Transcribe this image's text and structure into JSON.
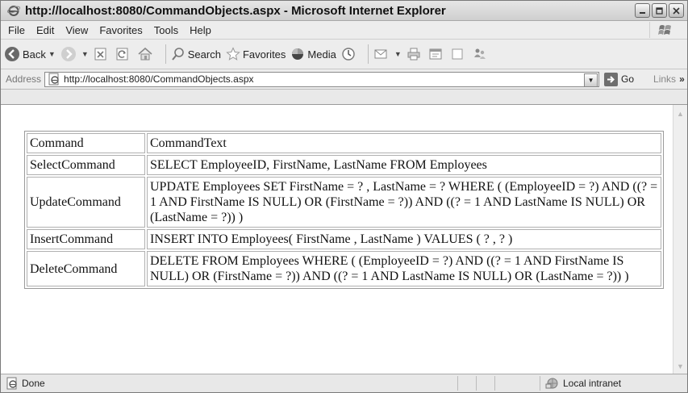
{
  "window": {
    "title": "http://localhost:8080/CommandObjects.aspx - Microsoft Internet Explorer",
    "controls": {
      "minimize": "minimize-icon",
      "maximize": "maximize-icon",
      "close": "close-icon"
    }
  },
  "menu": {
    "items": [
      "File",
      "Edit",
      "View",
      "Favorites",
      "Tools",
      "Help"
    ]
  },
  "toolbar": {
    "back_label": "Back",
    "search_label": "Search",
    "favorites_label": "Favorites",
    "media_label": "Media"
  },
  "address": {
    "label": "Address",
    "url": "http://localhost:8080/CommandObjects.aspx",
    "go_label": "Go",
    "links_label": "Links",
    "chevron": "»"
  },
  "table": {
    "rows": [
      {
        "name": "Command",
        "text": "CommandText"
      },
      {
        "name": "SelectCommand",
        "text": "SELECT EmployeeID, FirstName, LastName FROM Employees"
      },
      {
        "name": "UpdateCommand",
        "text": "UPDATE Employees SET FirstName = ? , LastName = ? WHERE ( (EmployeeID = ?) AND ((? = 1 AND FirstName IS NULL) OR (FirstName = ?)) AND ((? = 1 AND LastName IS NULL) OR (LastName = ?)) )"
      },
      {
        "name": "InsertCommand",
        "text": "INSERT INTO Employees( FirstName , LastName ) VALUES ( ? , ? )"
      },
      {
        "name": "DeleteCommand",
        "text": "DELETE FROM Employees WHERE ( (EmployeeID = ?) AND ((? = 1 AND FirstName IS NULL) OR (FirstName = ?)) AND ((? = 1 AND LastName IS NULL) OR (LastName = ?)) )"
      }
    ]
  },
  "status": {
    "text": "Done",
    "zone": "Local intranet"
  }
}
